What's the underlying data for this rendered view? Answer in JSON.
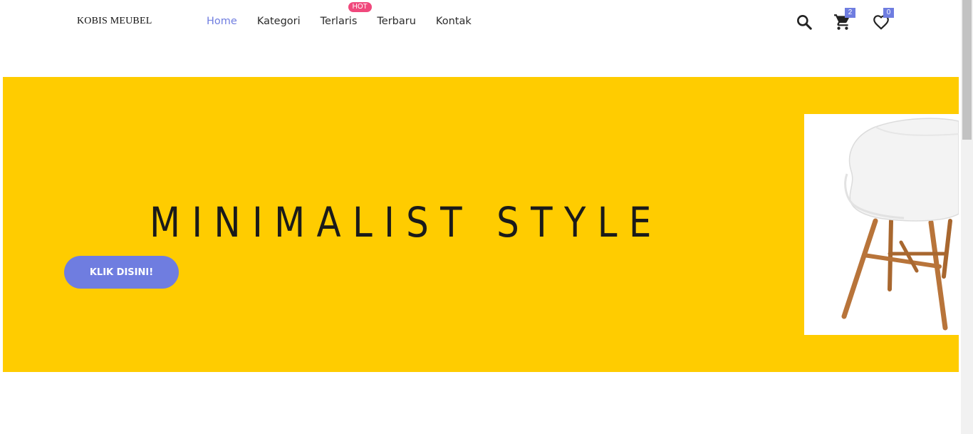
{
  "brand": {
    "name": "KOBIS MEUBEL"
  },
  "nav": {
    "items": [
      {
        "label": "Home",
        "active": true
      },
      {
        "label": "Kategori"
      },
      {
        "label": "Terlaris",
        "badge": "HOT"
      },
      {
        "label": "Terbaru"
      },
      {
        "label": "Kontak"
      }
    ]
  },
  "header_icons": {
    "search": {
      "icon": "search-icon"
    },
    "cart": {
      "icon": "cart-icon",
      "count": "2"
    },
    "wishlist": {
      "icon": "heart-icon",
      "count": "0"
    }
  },
  "hero": {
    "title": "MINIMALIST STYLE",
    "button_label": "KLIK DISINI!",
    "image": "white-chair-with-wooden-legs"
  },
  "colors": {
    "accent": "#6f7de0",
    "hero_bg": "#ffcc00",
    "hot_badge": "#f0487c"
  }
}
